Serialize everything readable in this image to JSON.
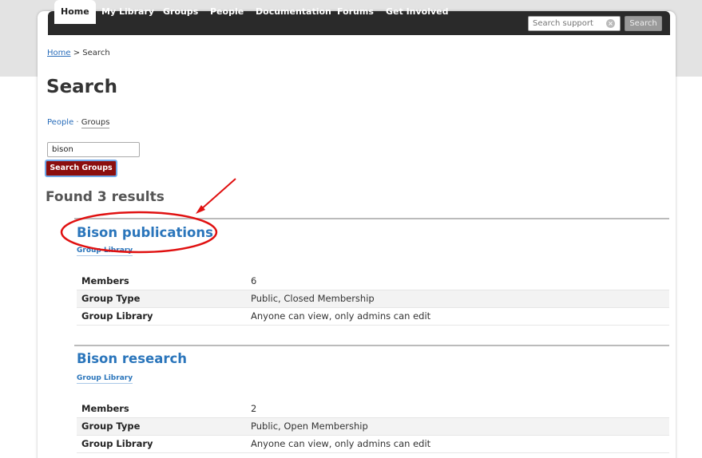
{
  "nav": {
    "items": [
      "Home",
      "My Library",
      "Groups",
      "People",
      "Documentation",
      "Forums",
      "Get Involved"
    ],
    "search_placeholder": "Search support",
    "search_button": "Search"
  },
  "breadcrumb": {
    "home": "Home",
    "separator": ">",
    "current": "Search"
  },
  "page_title": "Search",
  "search_nav": {
    "people": "People",
    "separator": "·",
    "groups": "Groups"
  },
  "query": {
    "value": "bison",
    "button": "Search Groups"
  },
  "results_heading": "Found 3 results",
  "results": [
    {
      "title": "Bison publications",
      "library_link": "Group Library",
      "rows": [
        {
          "label": "Members",
          "value": "6"
        },
        {
          "label": "Group Type",
          "value": "Public, Closed Membership"
        },
        {
          "label": "Group Library",
          "value": "Anyone can view, only admins can edit"
        }
      ]
    },
    {
      "title": "Bison research",
      "library_link": "Group Library",
      "rows": [
        {
          "label": "Members",
          "value": "2"
        },
        {
          "label": "Group Type",
          "value": "Public, Open Membership"
        },
        {
          "label": "Group Library",
          "value": "Anyone can view, only admins can edit"
        }
      ]
    }
  ],
  "colors": {
    "annotation": "#e01010",
    "link": "#2a75bb",
    "button": "#8b0e0e"
  },
  "icons": {
    "clear": "clear-circle-icon"
  }
}
